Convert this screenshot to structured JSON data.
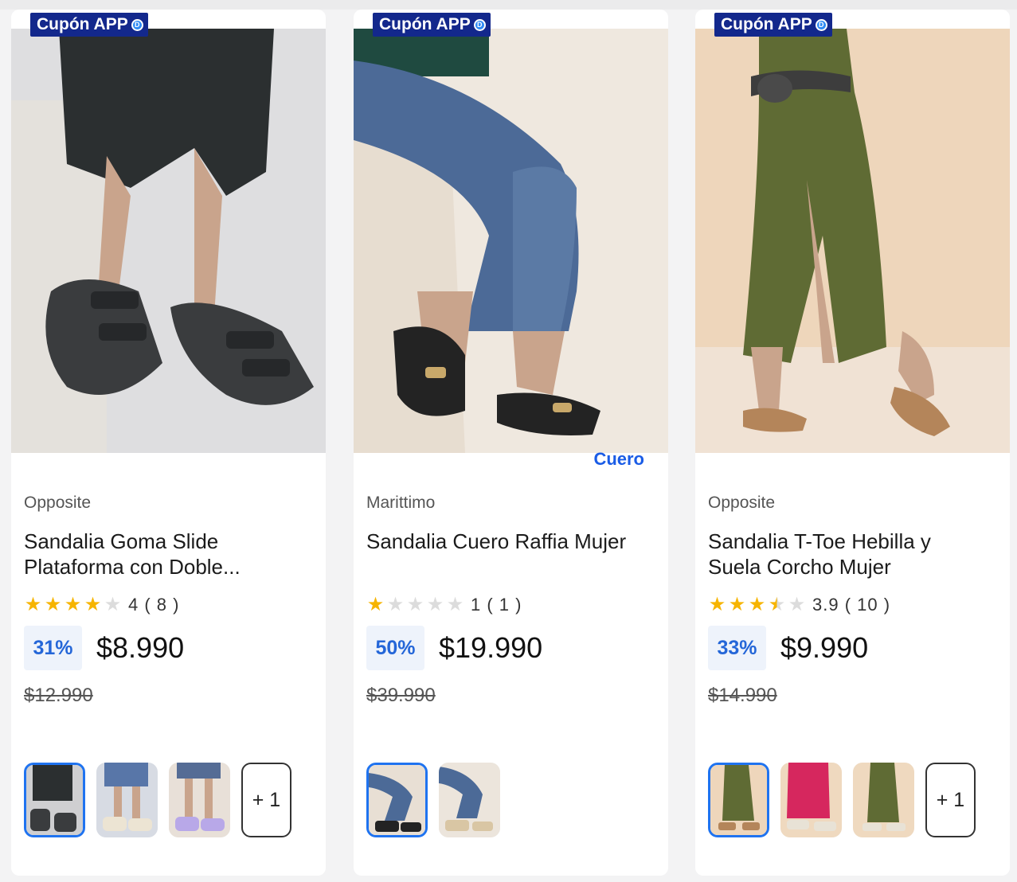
{
  "products": [
    {
      "badge": "Cupón APP",
      "brand": "Opposite",
      "name": "Sandalia Goma Slide Plataforma con Doble...",
      "rating_value": 4,
      "rating_text": "4 ( 8 )",
      "discount": "31%",
      "price": "$8.990",
      "original_price": "$12.990",
      "tag": "",
      "extra_colors": "+ 1",
      "colors": {
        "accent": "#1f73f0",
        "coupon": "#13288c"
      }
    },
    {
      "badge": "Cupón APP",
      "brand": "Marittimo",
      "name": "Sandalia Cuero Raffia Mujer",
      "rating_value": 1,
      "rating_text": "1 ( 1 )",
      "discount": "50%",
      "price": "$19.990",
      "original_price": "$39.990",
      "tag": "Cuero",
      "extra_colors": "",
      "colors": {
        "accent": "#1f73f0",
        "coupon": "#13288c"
      }
    },
    {
      "badge": "Cupón APP",
      "brand": "Opposite",
      "name": "Sandalia T-Toe Hebilla y Suela Corcho Mujer",
      "rating_value": 3.5,
      "rating_text": "3.9 ( 10 )",
      "discount": "33%",
      "price": "$9.990",
      "original_price": "$14.990",
      "tag": "",
      "extra_colors": "+ 1",
      "colors": {
        "accent": "#1f73f0",
        "coupon": "#13288c"
      }
    }
  ]
}
